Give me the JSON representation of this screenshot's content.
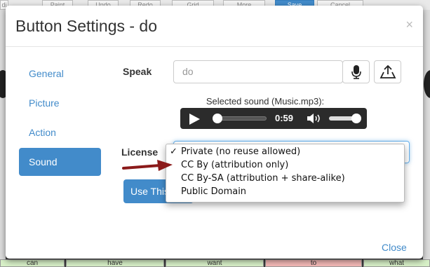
{
  "background": {
    "toolbar_tabs": [
      "di",
      "Paint",
      "Undo",
      "Redo",
      "Grid",
      "More",
      "Save",
      "Cancel"
    ],
    "bottom_words": [
      "can",
      "have",
      "want",
      "to",
      "what"
    ]
  },
  "modal": {
    "title": "Button Settings - do",
    "close_glyph": "×",
    "nav": [
      {
        "label": "General"
      },
      {
        "label": "Picture"
      },
      {
        "label": "Action"
      },
      {
        "label": "Sound",
        "active": true
      }
    ],
    "speak": {
      "label": "Speak",
      "value": "do",
      "mic_icon": "microphone-icon",
      "upload_icon": "upload-icon"
    },
    "selected_sound": "Selected sound (Music.mp3):",
    "audio": {
      "time": "0:59",
      "progress": 0.0,
      "volume": 0.85
    },
    "license": {
      "label": "License",
      "options": [
        {
          "label": "Private (no reuse allowed)",
          "checked": true
        },
        {
          "label": "CC By (attribution only)"
        },
        {
          "label": "CC By-SA (attribution + share-alike)"
        },
        {
          "label": "Public Domain"
        }
      ],
      "check_glyph": "✓"
    },
    "use_button": "Use This",
    "close_label": "Close",
    "accent": "#428bca",
    "arrow_color": "#8b1a1a"
  }
}
